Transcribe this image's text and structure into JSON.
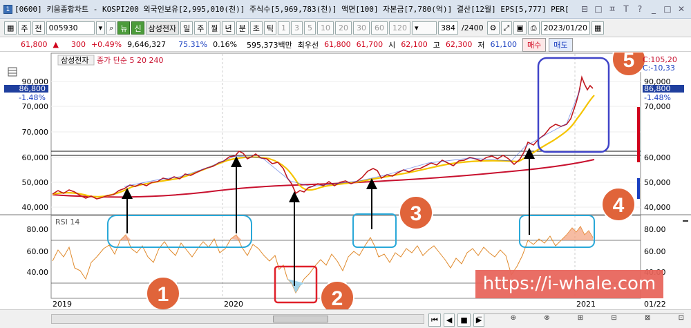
{
  "window": {
    "number": "1",
    "title": "[0600] 키움종합차트 - KOSPI200 외국인보유[2,995,010(천)] 주식수[5,969,783(천)] 액면[100] 자본금[7,780(억)] 결산[12월] EPS[5,777] PER[",
    "controls": [
      "⊟",
      "□",
      "ㅍ",
      "T",
      "?",
      "_",
      "□",
      "✕"
    ]
  },
  "toolbar": {
    "mode": "주",
    "type": "전",
    "code": "005930",
    "news_label": "뉴",
    "credit_label": "신",
    "stock_name": "삼성전자",
    "periods": [
      "일",
      "주",
      "월",
      "년",
      "분",
      "초",
      "틱"
    ],
    "minutes": [
      "1",
      "3",
      "5",
      "10",
      "20",
      "30",
      "60",
      "120"
    ],
    "count": "384",
    "total": "/2400",
    "date": "2023/01/20"
  },
  "quote": {
    "price": "61,800",
    "change_sign": "▲",
    "change": "300",
    "change_pct": "+0.49%",
    "volume": "9,646,327",
    "ratio1": "75.31%",
    "ratio2": "0.16%",
    "amount": "595,373백만",
    "best_ask_label": "최우선",
    "ask": "61,800",
    "bid": "61,700",
    "open_label": "시",
    "open": "62,100",
    "high_label": "고",
    "high": "62,300",
    "low_label": "저",
    "low": "61,100",
    "buy_label": "매수",
    "sell_label": "매도"
  },
  "price_panel": {
    "stock": "삼성전자",
    "legend": "종가 단순 5  20  240",
    "y_ticks": [
      "90,000",
      "80,000",
      "70,000",
      "60,000",
      "50,000",
      "40,000"
    ],
    "badge_price": "86,800",
    "badge_pct": "-1.48%",
    "right_top1": "C:105,20",
    "right_top2": "C:-10,33"
  },
  "rsi_panel": {
    "label": "RSI 14",
    "y_ticks": [
      "80.00",
      "60.00",
      "40.00"
    ],
    "right_ticks": [
      "80.00",
      "60.00",
      "40.00"
    ]
  },
  "x_labels": [
    "2019",
    "2020",
    "2021",
    "01/22"
  ],
  "annotations": [
    "1",
    "2",
    "3",
    "4",
    "5"
  ],
  "watermark": "https://i-whale.com",
  "colors": {
    "ma5": "#d0021b",
    "ma20": "#f5c400",
    "ma240": "#c8102e",
    "rsi": "#e08a2c",
    "cyan": "#29a8d8",
    "red_box": "#e0202a",
    "blue_box": "#4044c8",
    "circle": "#e0643a"
  },
  "chart_data": {
    "type": "line",
    "title": "",
    "series": [
      {
        "name": "종가",
        "x": [
          "2019-01",
          "2019-04",
          "2019-07",
          "2019-10",
          "2020-01",
          "2020-03",
          "2020-06",
          "2020-09",
          "2020-11",
          "2021-01",
          "2021-02"
        ],
        "values": [
          38500,
          45000,
          45500,
          50000,
          61000,
          43000,
          51000,
          58000,
          66000,
          88000,
          84000
        ]
      },
      {
        "name": "240",
        "x": [
          "2019-01",
          "2019-07",
          "2020-01",
          "2020-07",
          "2021-01",
          "2021-02"
        ],
        "values": [
          44500,
          46500,
          48000,
          51500,
          56500,
          58500
        ]
      }
    ],
    "ylim": [
      38000,
      95000
    ]
  }
}
